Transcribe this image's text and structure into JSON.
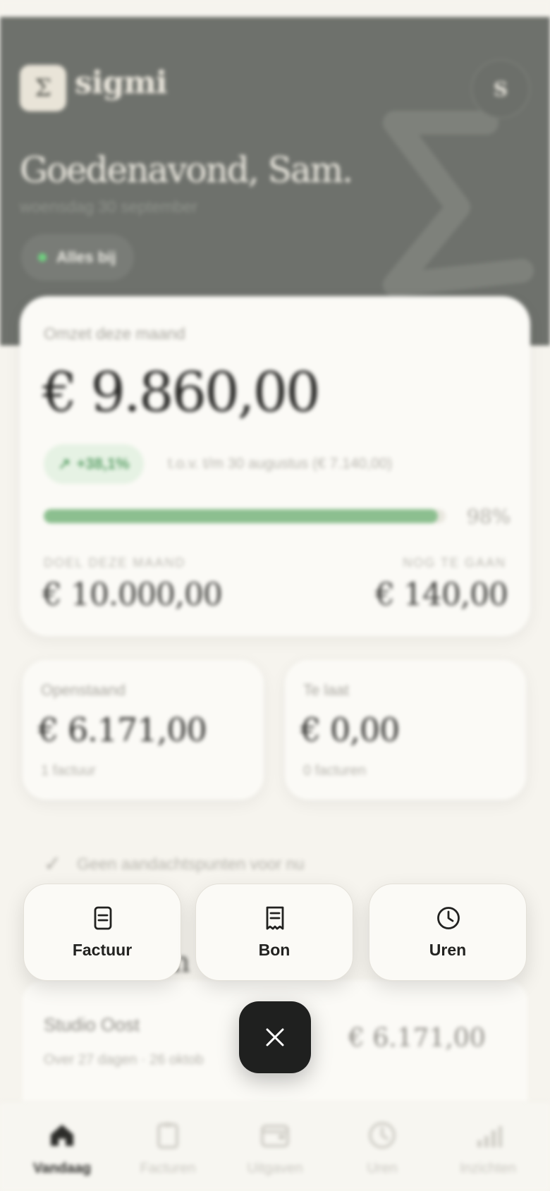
{
  "app": {
    "name": "sigmi",
    "logo_glyph": "Σ",
    "avatar_initial": "S"
  },
  "header": {
    "greeting": "Goedenavond, Sam.",
    "date": "woensdag 30 september",
    "status": "Alles bij"
  },
  "revenue": {
    "label": "Omzet deze maand",
    "value": "€ 9.860,00",
    "delta": "+38,1%",
    "delta_note": "t.o.v. t/m 30 augustus (€ 7.140,00)",
    "progress_percent": 98,
    "progress_label": "98%",
    "goal_label": "DOEL DEZE MAAND",
    "goal_value": "€ 10.000,00",
    "togo_label": "NOG TE GAAN",
    "togo_value": "€ 140,00"
  },
  "stats": {
    "open": {
      "label": "Openstaand",
      "value": "€ 6.171,00",
      "sub": "1 factuur"
    },
    "late": {
      "label": "Te laat",
      "value": "€ 0,00",
      "sub": "0 facturen"
    }
  },
  "notice": {
    "text": "Geen aandachtspunten voor nu"
  },
  "section": {
    "heading_fragment": "n"
  },
  "invoice_row": {
    "client": "Studio Oost",
    "meta": "Over 27 dagen · 26 oktob",
    "amount": "€ 6.171,00"
  },
  "actions": {
    "invoice_label": "Factuur",
    "receipt_label": "Bon",
    "hours_label": "Uren"
  },
  "nav": {
    "today": "Vandaag",
    "invoices": "Facturen",
    "expenses": "Uitgaven",
    "hours": "Uren",
    "insights": "Inzichten"
  },
  "colors": {
    "hero": "#6e716c",
    "background": "#f6f4ee",
    "accent_green": "#8cbf8f",
    "fab": "#1f201f"
  }
}
